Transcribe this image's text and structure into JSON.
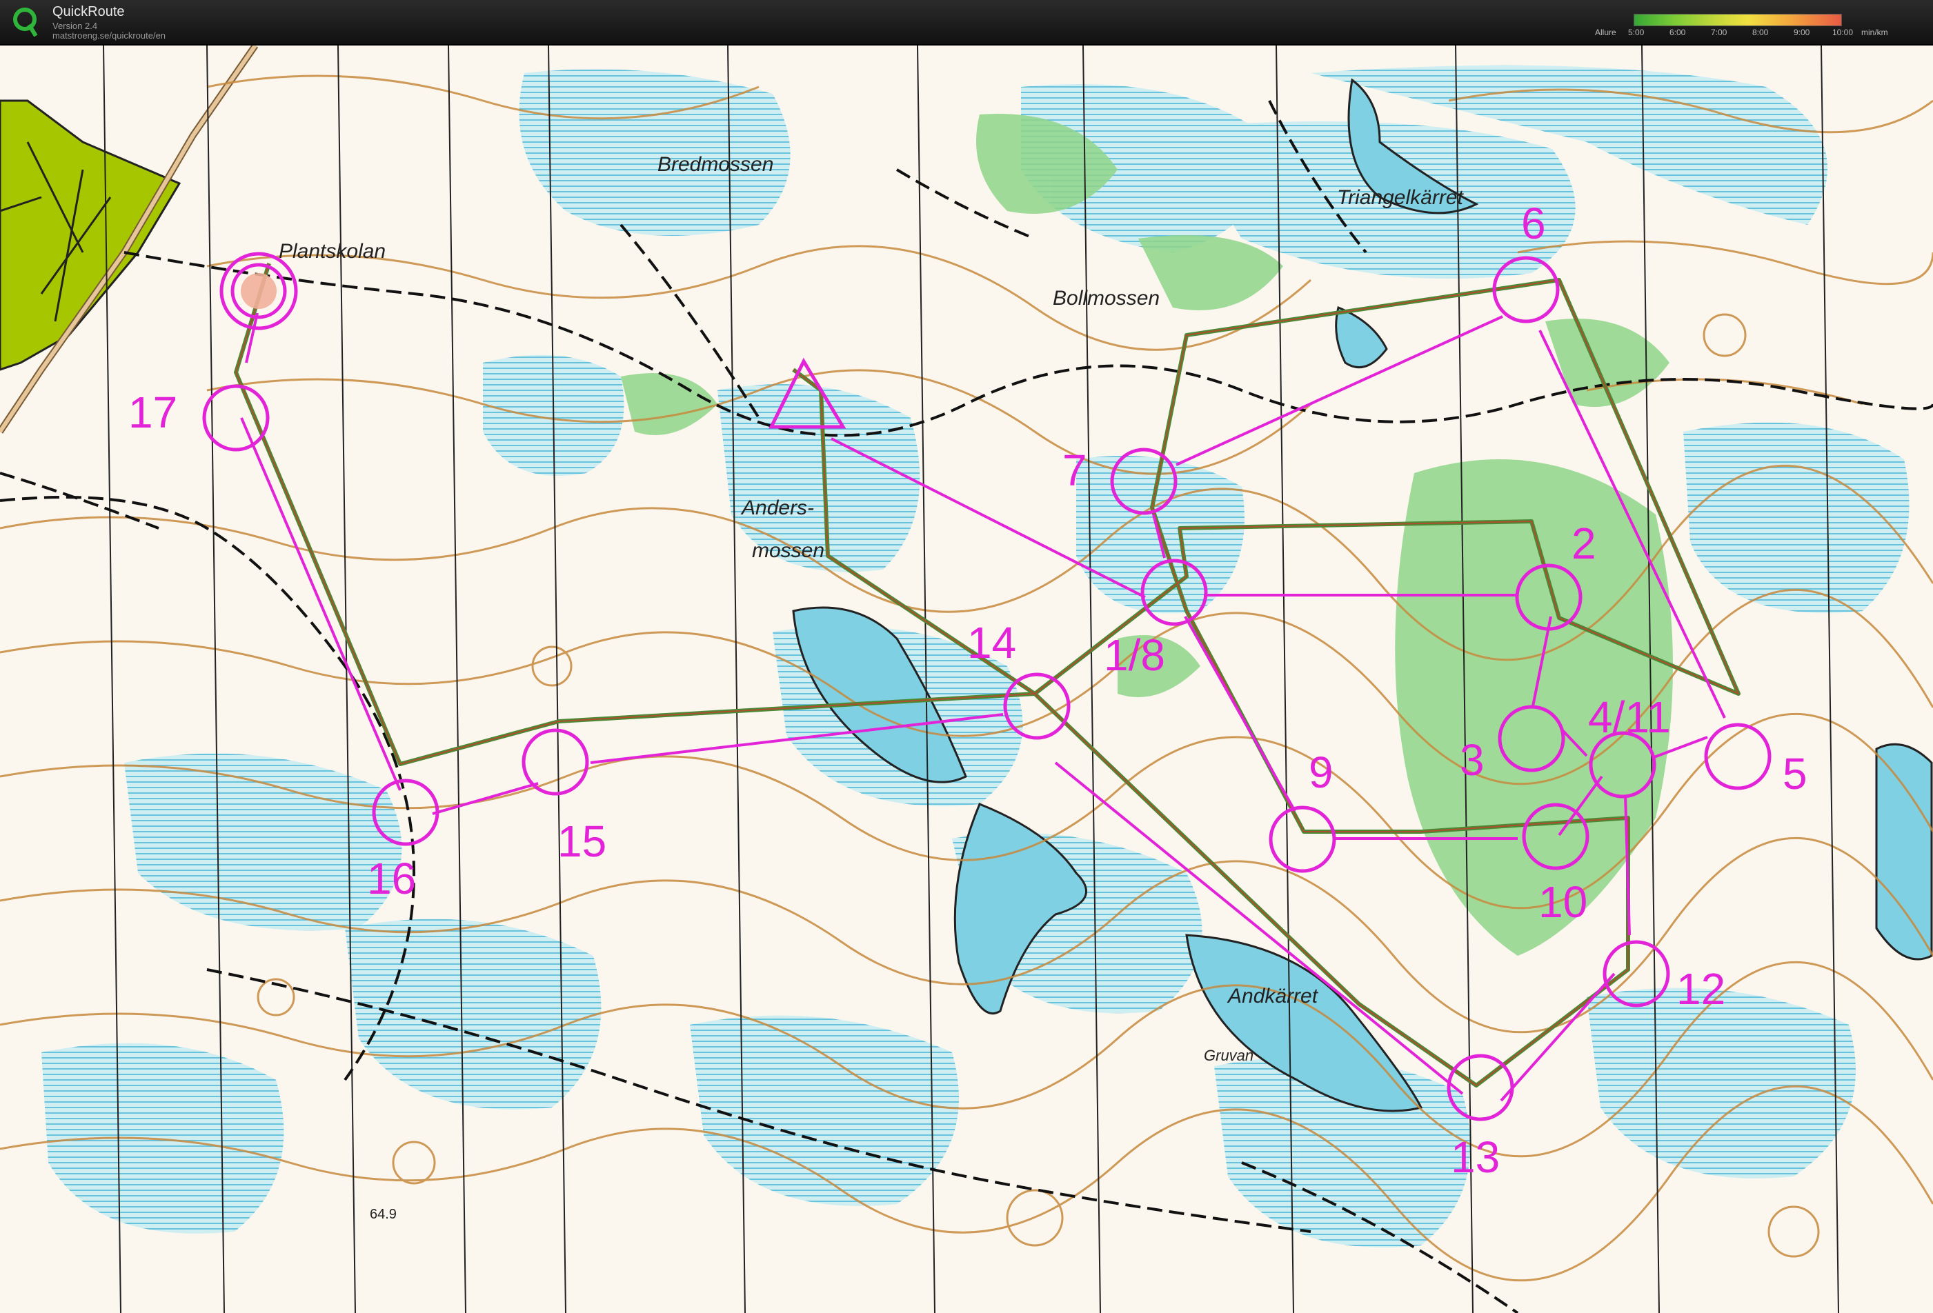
{
  "app": {
    "title": "QuickRoute",
    "version": "Version 2.4",
    "url": "matstroeng.se/quickroute/en"
  },
  "pace_legend": {
    "label": "Allure",
    "ticks": [
      "5:00",
      "6:00",
      "7:00",
      "8:00",
      "9:00",
      "10:00"
    ],
    "unit": "min/km"
  },
  "colors": {
    "course": "#e223d8",
    "water": "#aadfe6",
    "contour": "#c7893d",
    "green": "#8fd58a",
    "route": "#4b8a35",
    "settlement": "#a6c600"
  },
  "place_names": {
    "bredmossen": "Bredmossen",
    "triangelkarret": "Triangelkärret",
    "plantskolan": "Plantskolan",
    "bollmossen": "Bollmossen",
    "andersmossen_1": "Anders-",
    "andersmossen_2": "mossen",
    "andkarret": "Andkärret",
    "gruvan": "Gruvan",
    "spot_height": "64.9"
  },
  "controls": {
    "c2": "2",
    "c3": "3",
    "c4_11": "4/11",
    "c5": "5",
    "c6": "6",
    "c7": "7",
    "c1_8": "1/8",
    "c9": "9",
    "c10": "10",
    "c12": "12",
    "c13": "13",
    "c14": "14",
    "c15": "15",
    "c16": "16",
    "c17": "17"
  }
}
